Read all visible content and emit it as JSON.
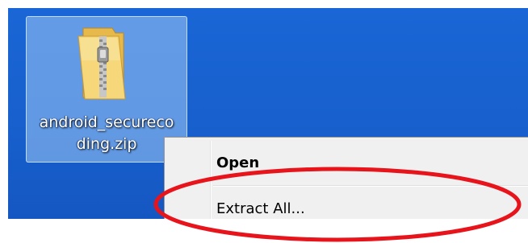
{
  "desktop": {
    "background_color": "#1760cd",
    "file": {
      "icon": "zip-folder-icon",
      "name_line1": "android_secureco",
      "name_line2": "ding.zip"
    }
  },
  "context_menu": {
    "items": [
      {
        "label": "Open",
        "bold": true
      },
      {
        "label": "Extract All...",
        "bold": false
      }
    ]
  },
  "annotation": {
    "shape": "ellipse",
    "color": "#e8141c",
    "target": "extract-all-menu-item"
  }
}
